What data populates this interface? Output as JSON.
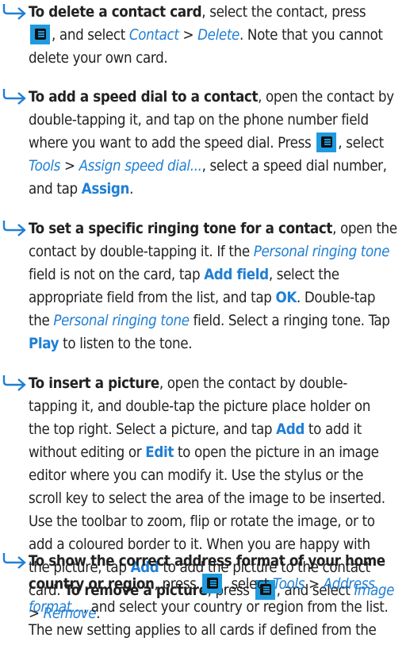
{
  "colors": {
    "accent": "#1f7fd4",
    "key": "#1e9be0"
  },
  "icons": {
    "bullet": "arrow-bullet-icon",
    "menu_key": "menu-key-icon"
  },
  "s1": {
    "t1": "To delete a contact card",
    "a": ", select the contact, press",
    "b": ", and select ",
    "c": "Contact",
    "d": " > ",
    "e": "Delete",
    "f": ". Note that you cannot",
    "g": "delete your own card."
  },
  "s2": {
    "t1": "To add a speed dial to a contact",
    "a": ", open the contact by",
    "b": "double-tapping it, and tap on the phone number field",
    "c": "where you want to add the speed dial. Press",
    "d": ", select",
    "e": "Tools",
    "f": " > ",
    "g": "Assign speed dial...",
    "h": ", select a speed dial number,",
    "i": "and tap ",
    "j": "Assign",
    "k": "."
  },
  "s3": {
    "t1": "To set a specific ringing tone for a contact",
    "a": ", open the",
    "b": "contact by double-tapping it. If the ",
    "c": "Personal ringing tone",
    "d": "field is not on the card, tap ",
    "e": "Add field",
    "f": ", select the",
    "g": "appropriate field from the list, and tap ",
    "h": "OK",
    "i": ". Double-tap",
    "j": "the ",
    "k": "Personal ringing tone",
    "l": " field. Select a ringing tone. Tap",
    "m": "Play",
    "n": " to listen to the tone."
  },
  "s4": {
    "t1": "To insert a picture",
    "a": ", open the contact by double-",
    "b": "tapping it, and double-tap the picture place holder on",
    "c": "the top right. Select a picture, and tap ",
    "d": "Add",
    "e": " to add it",
    "f": "without editing or ",
    "g": "Edit",
    "h": " to open the picture in an image",
    "i": "editor where you can modify it. Use the stylus or the",
    "j": "scroll key to select the area of the image to be inserted.",
    "k": "Use the toolbar to zoom, flip or rotate the image, or to",
    "l": "add a coloured border to it. When you are happy with",
    "m": "the picture, tap ",
    "n": "Add",
    "o": " to add the picture to the contact",
    "p": "card. ",
    "q": "To remove a picture",
    "r": ", press",
    "s": ", and select ",
    "t": "Image",
    "u": "> ",
    "v": "Remove",
    "w": "."
  },
  "s5": {
    "t1": "To show the correct address format of your home",
    "t2": "country or region",
    "a": ", press",
    "b": ", select ",
    "c": "Tools",
    "d": " > ",
    "e": "Address",
    "f": "format...",
    "g": ", and select your country or region from the list.",
    "h": "The new setting applies to all cards if defined from the"
  }
}
